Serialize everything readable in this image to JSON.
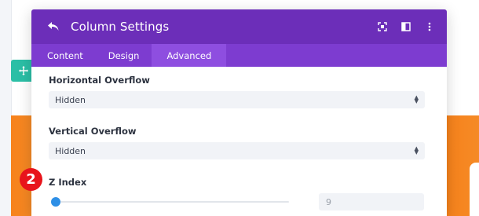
{
  "modal": {
    "title": "Column Settings",
    "tabs": [
      {
        "label": "Content",
        "active": false
      },
      {
        "label": "Design",
        "active": false
      },
      {
        "label": "Advanced",
        "active": true
      }
    ],
    "fields": {
      "horizontal_overflow": {
        "label": "Horizontal Overflow",
        "value": "Hidden"
      },
      "vertical_overflow": {
        "label": "Vertical Overflow",
        "value": "Hidden"
      },
      "z_index": {
        "label": "Z Index",
        "value": "9",
        "slider_fraction": 0
      }
    }
  },
  "annotation": {
    "step_number": "2"
  },
  "colors": {
    "header": "#6c2eb9",
    "tabs": "#7d3cd0",
    "active_tab": "#8e4ee0",
    "slider_thumb": "#2e8fe6",
    "badge": "#e8141b",
    "teal_handle": "#2bbfa6",
    "orange_section": "#f7821b"
  },
  "icons": [
    "back-arrow-icon",
    "expand-icon",
    "sidebar-toggle-icon",
    "more-vertical-icon",
    "move-icon"
  ]
}
